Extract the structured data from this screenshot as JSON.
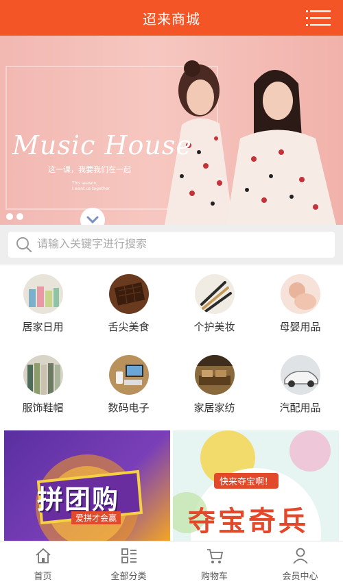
{
  "header": {
    "title": "迢来商城",
    "menu_icon": "hamburger-menu-icon"
  },
  "banner": {
    "script_text": "Music House",
    "subtitle": "这一课，我要我们在一起",
    "caption_line1": "This season,",
    "caption_line2": "I want us together",
    "scroll_icon": "chevron-down-icon",
    "slides_count": 2,
    "bg_color": "#f4bcb5"
  },
  "search": {
    "placeholder": "请输入关键字进行搜索",
    "icon": "search-icon"
  },
  "categories": [
    {
      "label": "居家日用",
      "icon": "household-icon"
    },
    {
      "label": "舌尖美食",
      "icon": "food-icon"
    },
    {
      "label": "个护美妆",
      "icon": "makeup-icon"
    },
    {
      "label": "母婴用品",
      "icon": "baby-icon"
    },
    {
      "label": "服饰鞋帽",
      "icon": "clothing-icon"
    },
    {
      "label": "数码电子",
      "icon": "digital-icon"
    },
    {
      "label": "家居家纺",
      "icon": "home-textile-icon"
    },
    {
      "label": "汽配用品",
      "icon": "auto-parts-icon"
    }
  ],
  "promos": [
    {
      "title": "拼团购",
      "tagline": "爱拼才会赢"
    },
    {
      "title": "夺宝奇兵",
      "tagline": "快来夺宝啊！"
    }
  ],
  "tabbar": [
    {
      "label": "首页",
      "icon": "home-icon"
    },
    {
      "label": "全部分类",
      "icon": "category-icon"
    },
    {
      "label": "购物车",
      "icon": "cart-icon"
    },
    {
      "label": "会员中心",
      "icon": "user-icon"
    }
  ],
  "colors": {
    "accent": "#f45527",
    "text": "#333333"
  }
}
